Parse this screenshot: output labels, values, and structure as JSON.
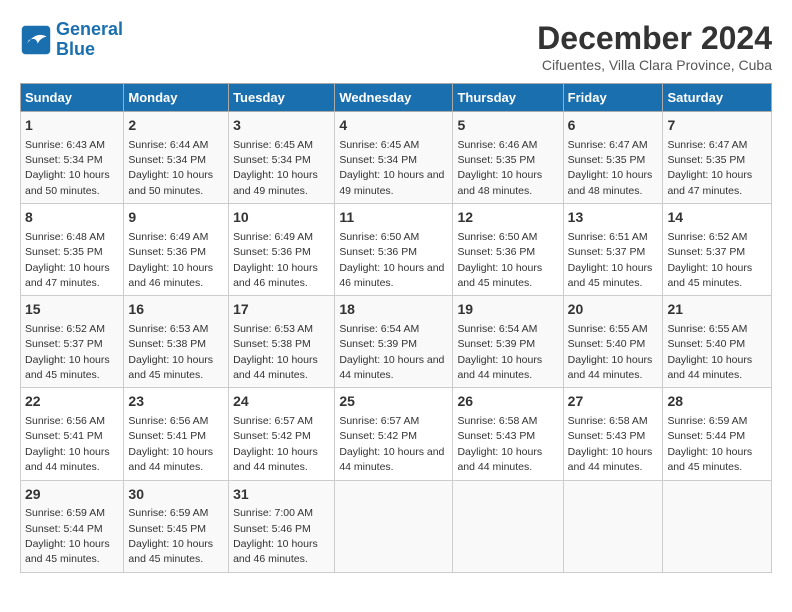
{
  "logo": {
    "line1": "General",
    "line2": "Blue"
  },
  "title": "December 2024",
  "subtitle": "Cifuentes, Villa Clara Province, Cuba",
  "headers": [
    "Sunday",
    "Monday",
    "Tuesday",
    "Wednesday",
    "Thursday",
    "Friday",
    "Saturday"
  ],
  "weeks": [
    [
      {
        "day": "1",
        "sunrise": "6:43 AM",
        "sunset": "5:34 PM",
        "daylight": "10 hours and 50 minutes."
      },
      {
        "day": "2",
        "sunrise": "6:44 AM",
        "sunset": "5:34 PM",
        "daylight": "10 hours and 50 minutes."
      },
      {
        "day": "3",
        "sunrise": "6:45 AM",
        "sunset": "5:34 PM",
        "daylight": "10 hours and 49 minutes."
      },
      {
        "day": "4",
        "sunrise": "6:45 AM",
        "sunset": "5:34 PM",
        "daylight": "10 hours and 49 minutes."
      },
      {
        "day": "5",
        "sunrise": "6:46 AM",
        "sunset": "5:35 PM",
        "daylight": "10 hours and 48 minutes."
      },
      {
        "day": "6",
        "sunrise": "6:47 AM",
        "sunset": "5:35 PM",
        "daylight": "10 hours and 48 minutes."
      },
      {
        "day": "7",
        "sunrise": "6:47 AM",
        "sunset": "5:35 PM",
        "daylight": "10 hours and 47 minutes."
      }
    ],
    [
      {
        "day": "8",
        "sunrise": "6:48 AM",
        "sunset": "5:35 PM",
        "daylight": "10 hours and 47 minutes."
      },
      {
        "day": "9",
        "sunrise": "6:49 AM",
        "sunset": "5:36 PM",
        "daylight": "10 hours and 46 minutes."
      },
      {
        "day": "10",
        "sunrise": "6:49 AM",
        "sunset": "5:36 PM",
        "daylight": "10 hours and 46 minutes."
      },
      {
        "day": "11",
        "sunrise": "6:50 AM",
        "sunset": "5:36 PM",
        "daylight": "10 hours and 46 minutes."
      },
      {
        "day": "12",
        "sunrise": "6:50 AM",
        "sunset": "5:36 PM",
        "daylight": "10 hours and 45 minutes."
      },
      {
        "day": "13",
        "sunrise": "6:51 AM",
        "sunset": "5:37 PM",
        "daylight": "10 hours and 45 minutes."
      },
      {
        "day": "14",
        "sunrise": "6:52 AM",
        "sunset": "5:37 PM",
        "daylight": "10 hours and 45 minutes."
      }
    ],
    [
      {
        "day": "15",
        "sunrise": "6:52 AM",
        "sunset": "5:37 PM",
        "daylight": "10 hours and 45 minutes."
      },
      {
        "day": "16",
        "sunrise": "6:53 AM",
        "sunset": "5:38 PM",
        "daylight": "10 hours and 45 minutes."
      },
      {
        "day": "17",
        "sunrise": "6:53 AM",
        "sunset": "5:38 PM",
        "daylight": "10 hours and 44 minutes."
      },
      {
        "day": "18",
        "sunrise": "6:54 AM",
        "sunset": "5:39 PM",
        "daylight": "10 hours and 44 minutes."
      },
      {
        "day": "19",
        "sunrise": "6:54 AM",
        "sunset": "5:39 PM",
        "daylight": "10 hours and 44 minutes."
      },
      {
        "day": "20",
        "sunrise": "6:55 AM",
        "sunset": "5:40 PM",
        "daylight": "10 hours and 44 minutes."
      },
      {
        "day": "21",
        "sunrise": "6:55 AM",
        "sunset": "5:40 PM",
        "daylight": "10 hours and 44 minutes."
      }
    ],
    [
      {
        "day": "22",
        "sunrise": "6:56 AM",
        "sunset": "5:41 PM",
        "daylight": "10 hours and 44 minutes."
      },
      {
        "day": "23",
        "sunrise": "6:56 AM",
        "sunset": "5:41 PM",
        "daylight": "10 hours and 44 minutes."
      },
      {
        "day": "24",
        "sunrise": "6:57 AM",
        "sunset": "5:42 PM",
        "daylight": "10 hours and 44 minutes."
      },
      {
        "day": "25",
        "sunrise": "6:57 AM",
        "sunset": "5:42 PM",
        "daylight": "10 hours and 44 minutes."
      },
      {
        "day": "26",
        "sunrise": "6:58 AM",
        "sunset": "5:43 PM",
        "daylight": "10 hours and 44 minutes."
      },
      {
        "day": "27",
        "sunrise": "6:58 AM",
        "sunset": "5:43 PM",
        "daylight": "10 hours and 44 minutes."
      },
      {
        "day": "28",
        "sunrise": "6:59 AM",
        "sunset": "5:44 PM",
        "daylight": "10 hours and 45 minutes."
      }
    ],
    [
      {
        "day": "29",
        "sunrise": "6:59 AM",
        "sunset": "5:44 PM",
        "daylight": "10 hours and 45 minutes."
      },
      {
        "day": "30",
        "sunrise": "6:59 AM",
        "sunset": "5:45 PM",
        "daylight": "10 hours and 45 minutes."
      },
      {
        "day": "31",
        "sunrise": "7:00 AM",
        "sunset": "5:46 PM",
        "daylight": "10 hours and 46 minutes."
      },
      {
        "day": "",
        "sunrise": "",
        "sunset": "",
        "daylight": ""
      },
      {
        "day": "",
        "sunrise": "",
        "sunset": "",
        "daylight": ""
      },
      {
        "day": "",
        "sunrise": "",
        "sunset": "",
        "daylight": ""
      },
      {
        "day": "",
        "sunrise": "",
        "sunset": "",
        "daylight": ""
      }
    ]
  ]
}
